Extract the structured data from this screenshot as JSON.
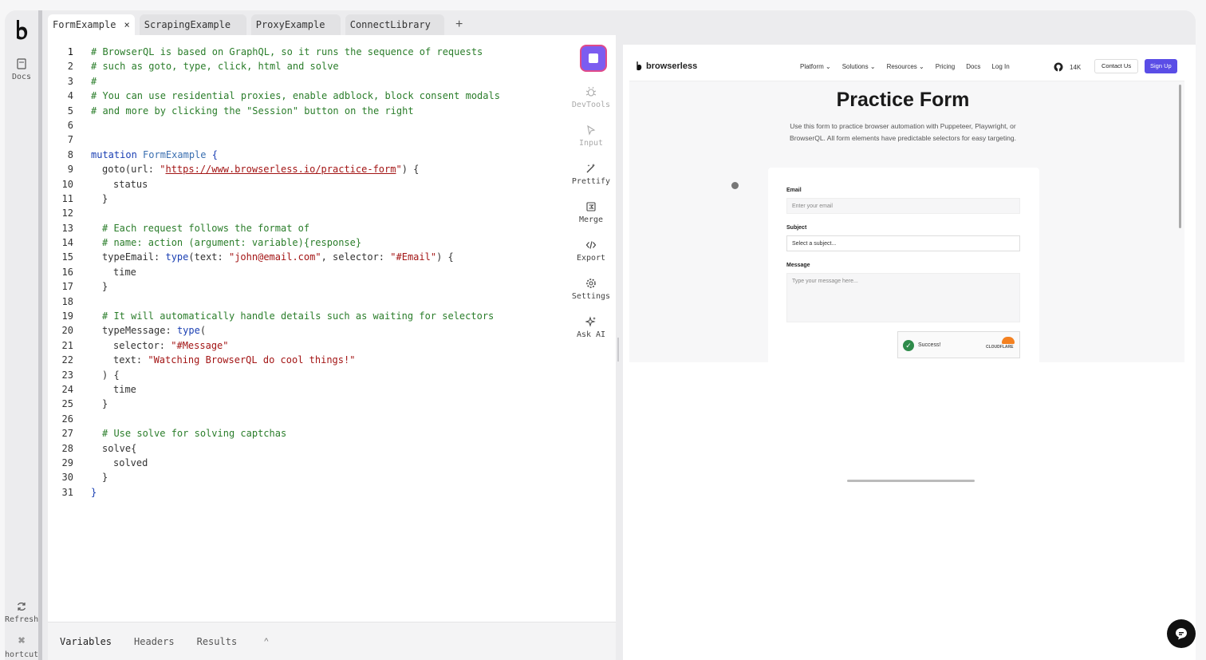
{
  "rail": {
    "docs_label": "Docs",
    "refresh_label": "Refresh",
    "shortcut_label": "hortcut"
  },
  "tabs": [
    {
      "label": "FormExample",
      "close": "×"
    },
    {
      "label": "ScrapingExample"
    },
    {
      "label": "ProxyExample"
    },
    {
      "label": "ConnectLibrary"
    }
  ],
  "tab_add": "+",
  "tools": {
    "devtools": "DevTools",
    "input": "Input",
    "prettify": "Prettify",
    "merge": "Merge",
    "export": "Export",
    "settings": "Settings",
    "ask_ai": "Ask AI"
  },
  "bottom_tabs": {
    "variables": "Variables",
    "headers": "Headers",
    "results": "Results",
    "chevron": "^"
  },
  "code": {
    "l1": "# BrowserQL is based on GraphQL, so it runs the sequence of requests",
    "l2": "# such as goto, type, click, html and solve",
    "l3": "#",
    "l4": "# You can use residential proxies, enable adblock, block consent modals",
    "l5": "# and more by clicking the \"Session\" button on the right",
    "l8a": "mutation",
    "l8b": "FormExample",
    "l8c": "{",
    "l9a": "goto(url: ",
    "l9q1": "\"",
    "l9u": "https://www.browserless.io/practice-form",
    "l9q2": "\"",
    "l9c": ") {",
    "l10": "status",
    "l11": "}",
    "l13": "# Each request follows the format of",
    "l14": "# name: action (argument: variable){response}",
    "l15a": "typeEmail",
    "l15b": ": ",
    "l15c": "type",
    "l15d": "(text: ",
    "l15e": "\"john@email.com\"",
    "l15f": ", selector: ",
    "l15g": "\"#Email\"",
    "l15h": ") {",
    "l16": "time",
    "l17": "}",
    "l19": "# It will automatically handle details such as waiting for selectors",
    "l20a": "typeMessage",
    "l20b": ": ",
    "l20c": "type",
    "l20d": "(",
    "l21a": "selector: ",
    "l21b": "\"#Message\"",
    "l22a": "text: ",
    "l22b": "\"Watching BrowserQL do cool things!\"",
    "l23": ") {",
    "l24": "time",
    "l25": "}",
    "l27": "# Use solve for solving captchas",
    "l28": "solve{",
    "l29": "solved",
    "l30": "}",
    "l31": "}"
  },
  "preview": {
    "brand": "browserless",
    "nav": [
      "Platform ⌄",
      "Solutions ⌄",
      "Resources ⌄",
      "Pricing",
      "Docs",
      "Log In"
    ],
    "stars": "14K",
    "contact": "Contact Us",
    "signup": "Sign Up",
    "title": "Practice Form",
    "subtitle": "Use this form to practice browser automation with Puppeteer, Playwright, or BrowserQL. All form elements have predictable selectors for easy targeting.",
    "email_label": "Email",
    "email_placeholder": "Enter your email",
    "subject_label": "Subject",
    "subject_placeholder": "Select a subject...",
    "message_label": "Message",
    "message_placeholder": "Type your message here...",
    "captcha_text": "Success!",
    "captcha_brand": "CLOUDFLARE"
  }
}
